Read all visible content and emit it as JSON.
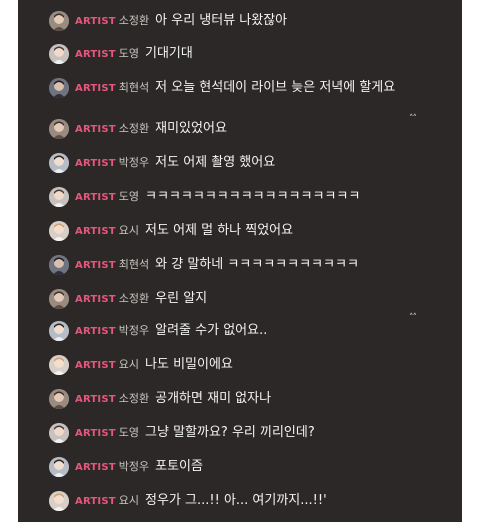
{
  "badge_label": "ARTIST",
  "colors": {
    "background": "#2b2827",
    "badge": "#e5577d",
    "name": "#cbc6c3",
    "text": "#f4f4f4"
  },
  "messages": [
    {
      "name": "소정환",
      "text": "아 우리 냉터뷰 나왔잖아"
    },
    {
      "name": "도영",
      "text": "기대기대"
    },
    {
      "name": "최현석",
      "text": "저 오늘 현석데이 라이브 늦은 저녁에 할게요"
    },
    {
      "name": "소정환",
      "text": "재미있었어요"
    },
    {
      "name": "박정우",
      "text": "저도 어제 촬영 했어요"
    },
    {
      "name": "도영",
      "text": "ㅋㅋㅋㅋㅋㅋㅋㅋㅋㅋㅋㅋㅋㅋㅋㅋㅋㅋ"
    },
    {
      "name": "요시",
      "text": "저도 어제 멀 하나 찍었어요"
    },
    {
      "name": "최현석",
      "text": "와 걍 말하네 ㅋㅋㅋㅋㅋㅋㅋㅋㅋㅋㅋ"
    },
    {
      "name": "소정환",
      "text": "우린 알지"
    },
    {
      "name": "박정우",
      "text": "알려줄 수가 없어요.."
    },
    {
      "name": "요시",
      "text": "나도 비밀이에요"
    },
    {
      "name": "소정환",
      "text": "공개하면 재미 없자나"
    },
    {
      "name": "도영",
      "text": "그냥 말할까요? 우리 끼리인데?"
    },
    {
      "name": "박정우",
      "text": "포토이즘"
    },
    {
      "name": "요시",
      "text": "정우가 그...!! 아... 여기까지...!!'"
    }
  ],
  "scroll_marker": "˄˄"
}
